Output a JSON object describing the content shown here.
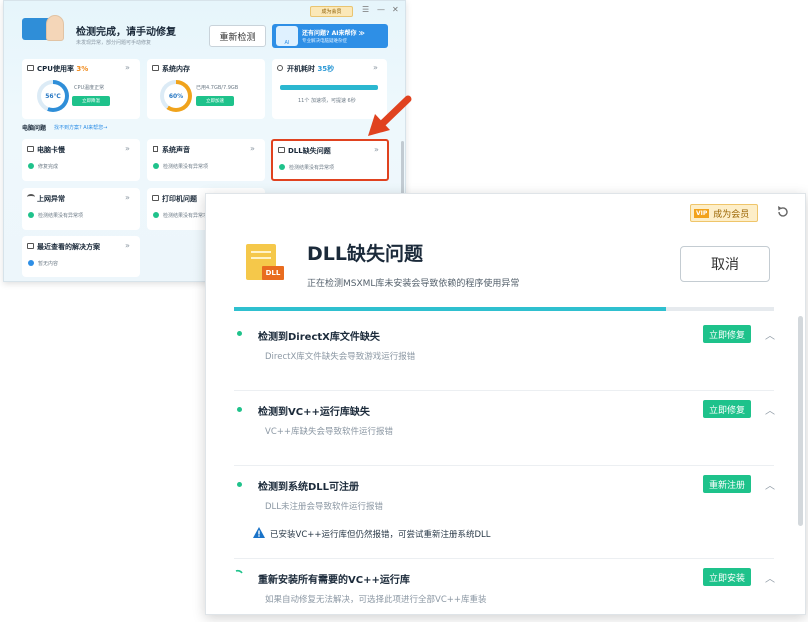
{
  "back_window": {
    "header": {
      "title": "检测完成，请手动修复",
      "subtitle": "未发现异常，部分问题可手动修复",
      "redetect_label": "重新检测",
      "vip_label": "成为会员",
      "ai_title": "还有问题? AI来帮你 ≫",
      "ai_sub": "专业解决电脑疑难杂症",
      "ai_badge": "AI"
    },
    "cards_top": [
      {
        "title": "CPU使用率",
        "value": "3%",
        "gauge": "56℃",
        "desc": "CPU温度正常",
        "button": "立即降温"
      },
      {
        "title": "系统内存",
        "gauge": "60%",
        "desc": "已用4.7GB/7.9GB",
        "button": "立即加速"
      },
      {
        "title": "开机耗时",
        "value": "35秒",
        "desc": "11个 加速项，可提速 6秒"
      }
    ],
    "section_label": "电脑问题",
    "section_link": "找不到方案? AI来帮您→",
    "cards_issues": [
      {
        "title": "电脑卡慢",
        "desc": "修复完成"
      },
      {
        "title": "系统声音",
        "desc": "检测结果没有异常项"
      },
      {
        "title": "DLL缺失问题",
        "desc": "检测结果没有异常项"
      },
      {
        "title": "上网异常",
        "desc": "检测结果没有异常项"
      },
      {
        "title": "打印机问题",
        "desc": "检测结果没有异常项"
      },
      {
        "title": "最近查看的解决方案",
        "desc": "暂无内容"
      }
    ],
    "window_controls": [
      "☰",
      "—",
      "✕"
    ],
    "chevron": "»"
  },
  "dialog": {
    "vip_label": "成为会员",
    "vip_badge": "VIP",
    "title": "DLL缺失问题",
    "subtitle": "正在检测MSXML库未安装会导致依赖的程序使用异常",
    "cancel_label": "取消",
    "file_icon_label": "DLL",
    "progress": 0.8,
    "issues": [
      {
        "title": "检测到DirectX库文件缺失",
        "desc": "DirectX库文件缺失会导致游戏运行报错",
        "button": "立即修复"
      },
      {
        "title": "检测到VC++运行库缺失",
        "desc": "VC++库缺失会导致软件运行报错",
        "button": "立即修复"
      },
      {
        "title": "检测到系统DLL可注册",
        "desc": "DLL未注册会导致软件运行报错",
        "button": "重新注册",
        "warning": "已安装VC++运行库但仍然报错，可尝试重新注册系统DLL"
      },
      {
        "title": "重新安装所有需要的VC++运行库",
        "desc": "如果自动修复无法解决，可选择此项进行全部VC++库重装",
        "button": "立即安装"
      }
    ]
  },
  "colors": {
    "accent": "#1ec28b",
    "highlight": "#e0421f",
    "progress": "#2fc0cf",
    "vip": "#f2b94b"
  },
  "icons": {
    "refresh": "refresh-icon",
    "chevron_up": "chevron-up-icon",
    "warning": "warning-icon",
    "arrow": "red-arrow"
  }
}
